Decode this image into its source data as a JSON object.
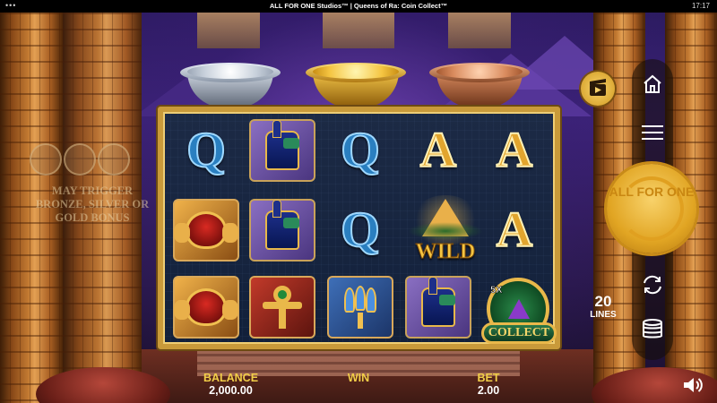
{
  "topbar": {
    "title": "ALL FOR ONE Studios™ | Queens of Ra: Coin Collect™",
    "clock": "17:17",
    "menu_dots": "•••"
  },
  "bowls": [
    {
      "name": "silver",
      "gem_color": "#3aa0e8"
    },
    {
      "name": "gold",
      "gem_color": "#e0282c"
    },
    {
      "name": "bronze",
      "gem_color": "#2aa84a"
    }
  ],
  "bonus_info": {
    "text": "MAY TRIGGER BRONZE, SILVER OR GOLD BONUS"
  },
  "reels": {
    "rows": [
      [
        "Q",
        "anubis",
        "Q",
        "A",
        "A"
      ],
      [
        "scarab",
        "anubis",
        "Q",
        "WILD",
        "A"
      ],
      [
        "scarab",
        "ankh",
        "lotus",
        "anubis",
        "collect"
      ]
    ],
    "wild_label": "WILD",
    "collect_label": "COLLECT",
    "collect_multiplier": "5X"
  },
  "controls": {
    "spin_label": "ALL FOR ONE",
    "lines_count": "20",
    "lines_label": "LINES"
  },
  "footer": {
    "balance_label": "BALANCE",
    "balance_value": "2,000.00",
    "win_label": "WIN",
    "bet_label": "BET",
    "bet_value": "2.00"
  },
  "colors": {
    "accent_gold": "#f2cf48",
    "frame_gold": "#c99a3a",
    "background": "#2a1a5e"
  }
}
